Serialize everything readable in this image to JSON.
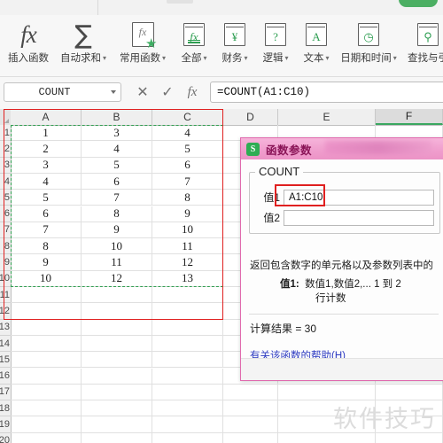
{
  "topbar": {
    "green_button": "",
    "grey_button": ""
  },
  "ribbon": {
    "items": [
      {
        "label": "插入函数",
        "icon": "fx-icon",
        "caret": false
      },
      {
        "label": "自动求和",
        "icon": "sigma-icon",
        "caret": true
      },
      {
        "label": "常用函数",
        "icon": "fx-star-icon",
        "caret": true
      },
      {
        "label": "全部",
        "icon": "book-fx-icon",
        "caret": true
      },
      {
        "label": "财务",
        "icon": "book-yen-icon",
        "caret": true
      },
      {
        "label": "逻辑",
        "icon": "book-question-icon",
        "caret": true
      },
      {
        "label": "文本",
        "icon": "book-letter-icon",
        "caret": true
      },
      {
        "label": "日期和时间",
        "icon": "book-clock-icon",
        "caret": true
      },
      {
        "label": "查找与引",
        "icon": "book-search-icon",
        "caret": false
      }
    ]
  },
  "formula_bar": {
    "name_box_value": "COUNT",
    "cancel_icon": "✕",
    "confirm_icon": "✓",
    "fx_icon": "fx",
    "formula": "=COUNT(A1:C10)"
  },
  "sheet": {
    "columns": [
      "A",
      "B",
      "C",
      "D",
      "E",
      "F"
    ],
    "active_column": "F",
    "rows": [
      "1",
      "2",
      "3",
      "4",
      "5",
      "6",
      "7",
      "8",
      "9",
      "10",
      "11",
      "12",
      "13",
      "14",
      "15",
      "16",
      "17",
      "18",
      "19",
      "20"
    ],
    "data": [
      [
        "1",
        "3",
        "4"
      ],
      [
        "2",
        "4",
        "5"
      ],
      [
        "3",
        "5",
        "6"
      ],
      [
        "4",
        "6",
        "7"
      ],
      [
        "5",
        "7",
        "8"
      ],
      [
        "6",
        "8",
        "9"
      ],
      [
        "7",
        "9",
        "10"
      ],
      [
        "8",
        "10",
        "11"
      ],
      [
        "9",
        "11",
        "12"
      ],
      [
        "10",
        "12",
        "13"
      ]
    ],
    "marching_ants_range": "A1:C10",
    "red_selection_range": "A1:C12"
  },
  "dialog": {
    "icon": "s-logo-icon",
    "icon_text": "S",
    "title": "函数参数",
    "function_name": "COUNT",
    "args": [
      {
        "label": "值1",
        "value": "A1:C10"
      },
      {
        "label": "值2",
        "value": ""
      }
    ],
    "description": "返回包含数字的单元格以及参数列表中的",
    "arg_help_label": "值1:",
    "arg_help_line1": "数值1,数值2,... 1 到 2",
    "arg_help_line2": "行计数",
    "result_label": "计算结果  =  30",
    "help_link": "有关该函数的帮助(H)"
  },
  "watermark": "软件技巧",
  "colors": {
    "dialog_border": "#e06aae",
    "title_pink": "#f0a0cf",
    "accent_green": "#2fad54",
    "selection_red": "#e02020",
    "ants_green": "#2f9e4f",
    "link_blue": "#2b39c0"
  }
}
